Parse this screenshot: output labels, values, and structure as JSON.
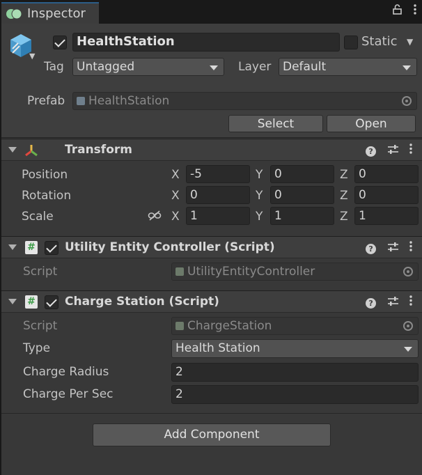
{
  "tab": {
    "label": "Inspector",
    "icons": [
      "lock-icon",
      "more-icon"
    ]
  },
  "gameobject": {
    "name": "HealthStation",
    "active": true,
    "static_label": "Static",
    "static_checked": false,
    "tag_label": "Tag",
    "tag_value": "Untagged",
    "layer_label": "Layer",
    "layer_value": "Default",
    "prefab_label": "Prefab",
    "prefab_value": "HealthStation",
    "select_label": "Select",
    "open_label": "Open"
  },
  "transform": {
    "title": "Transform",
    "position_label": "Position",
    "rotation_label": "Rotation",
    "scale_label": "Scale",
    "axis_x": "X",
    "axis_y": "Y",
    "axis_z": "Z",
    "position": {
      "x": "-5",
      "y": "0",
      "z": "0"
    },
    "rotation": {
      "x": "0",
      "y": "0",
      "z": "0"
    },
    "scale": {
      "x": "1",
      "y": "1",
      "z": "1"
    }
  },
  "utility_component": {
    "title": "Utility Entity Controller (Script)",
    "enabled": true,
    "script_label": "Script",
    "script_value": "UtilityEntityController"
  },
  "charge_component": {
    "title": "Charge Station (Script)",
    "enabled": true,
    "script_label": "Script",
    "script_value": "ChargeStation",
    "type_label": "Type",
    "type_value": "Health Station",
    "radius_label": "Charge Radius",
    "radius_value": "2",
    "per_sec_label": "Charge Per Sec",
    "per_sec_value": "2"
  },
  "add_component_label": "Add Component",
  "colors": {
    "background": "#383838",
    "header": "#3e3e3e",
    "field": "#2a2a2a",
    "tab_accent": "#2c5d87"
  }
}
